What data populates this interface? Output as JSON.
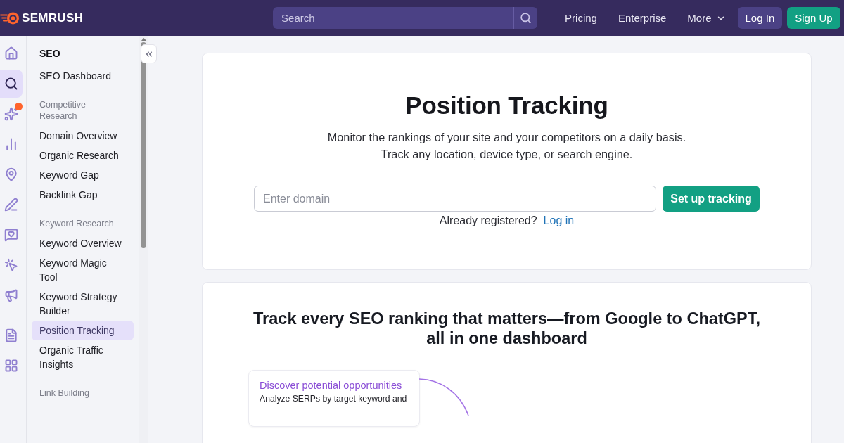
{
  "top_nav": {
    "logo": "SEMRUSH",
    "search": {
      "placeholder": "Search"
    },
    "links": [
      {
        "label": "Pricing",
        "kind": "link"
      },
      {
        "label": "Enterprise",
        "kind": "link"
      },
      {
        "label": "More",
        "kind": "menu"
      }
    ],
    "buttons": [
      {
        "label": "Log In",
        "kind": "login"
      },
      {
        "label": "Sign Up",
        "kind": "signup"
      }
    ]
  },
  "icon_rail": {
    "groups": [
      {
        "items": [
          {
            "kind": "house",
            "selected": false,
            "notification": false
          },
          {
            "kind": "magnifier",
            "selected": true,
            "notification": false
          },
          {
            "kind": "sparkles",
            "selected": false,
            "notification": true
          },
          {
            "kind": "bar-chart",
            "selected": false,
            "notification": false
          },
          {
            "kind": "pin",
            "selected": false,
            "notification": false
          },
          {
            "kind": "pencil",
            "selected": false,
            "notification": false
          },
          {
            "kind": "heart-message",
            "selected": false,
            "notification": false
          },
          {
            "kind": "cursor",
            "selected": false,
            "notification": false
          },
          {
            "kind": "megaphone",
            "selected": false,
            "notification": false
          }
        ]
      },
      {
        "items": [
          {
            "kind": "document",
            "selected": false,
            "notification": false
          },
          {
            "kind": "grid",
            "selected": false,
            "notification": false
          }
        ]
      }
    ]
  },
  "nav_panel": {
    "title": "SEO",
    "items": [
      {
        "label": "SEO Dashboard",
        "selected": false
      }
    ],
    "sections": [
      {
        "heading": "Competitive Research",
        "items": [
          {
            "label": "Domain Overview",
            "selected": false
          },
          {
            "label": "Organic Research",
            "selected": false
          },
          {
            "label": "Keyword Gap",
            "selected": false
          },
          {
            "label": "Backlink Gap",
            "selected": false
          }
        ]
      },
      {
        "heading": "Keyword Research",
        "items": [
          {
            "label": "Keyword Overview",
            "selected": false
          },
          {
            "label": "Keyword Magic Tool",
            "selected": false
          },
          {
            "label": "Keyword Strategy Builder",
            "selected": false
          },
          {
            "label": "Position Tracking",
            "selected": true
          },
          {
            "label": "Organic Traffic Insights",
            "selected": false
          }
        ]
      },
      {
        "heading": "Link Building"
      }
    ]
  },
  "intro_card": {
    "title": "Position Tracking",
    "description_lines": [
      "Monitor the rankings of your site and your competitors on a daily basis.",
      "Track any location, device type, or search engine."
    ],
    "domain_field": {
      "placeholder": "Enter domain"
    },
    "submit_button": "Set up tracking",
    "login_prompt": {
      "text": "Already registered?",
      "link": "Log in"
    }
  },
  "features_card": {
    "heading": "Track every SEO ranking that matters—from Google to ChatGPT, all in one dashboard",
    "feature": {
      "title": "Discover potential opportunities",
      "text": "Analyze SERPs by target keyword and"
    }
  }
}
